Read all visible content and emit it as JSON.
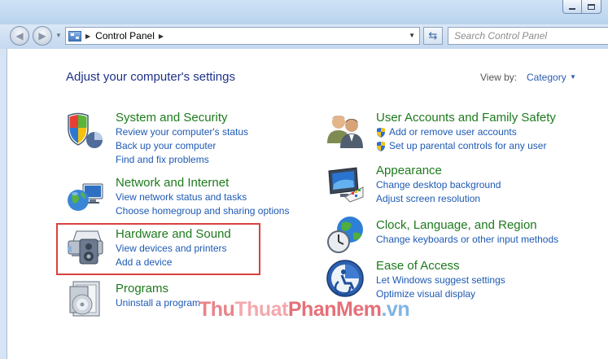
{
  "window": {
    "address": {
      "crumb": "Control Panel"
    },
    "search": {
      "placeholder": "Search Control Panel"
    }
  },
  "header": {
    "title": "Adjust your computer's settings",
    "view_by_label": "View by:",
    "view_by_value": "Category"
  },
  "categories": {
    "system": {
      "title": "System and Security",
      "icon": "shield-icon",
      "links": [
        "Review your computer's status",
        "Back up your computer",
        "Find and fix problems"
      ]
    },
    "network": {
      "title": "Network and Internet",
      "icon": "globe-network-icon",
      "links": [
        "View network status and tasks",
        "Choose homegroup and sharing options"
      ]
    },
    "hardware": {
      "title": "Hardware and Sound",
      "icon": "printer-speaker-icon",
      "links": [
        "View devices and printers",
        "Add a device"
      ]
    },
    "programs": {
      "title": "Programs",
      "icon": "programs-disc-icon",
      "links": [
        "Uninstall a program"
      ]
    },
    "users": {
      "title": "User Accounts and Family Safety",
      "icon": "users-icon",
      "links": [
        "Add or remove user accounts",
        "Set up parental controls for any user"
      ]
    },
    "appearance": {
      "title": "Appearance",
      "icon": "monitor-palette-icon",
      "links": [
        "Change desktop background",
        "Adjust screen resolution"
      ]
    },
    "clock": {
      "title": "Clock, Language, and Region",
      "icon": "clock-globe-icon",
      "links": [
        "Change keyboards or other input methods"
      ]
    },
    "ease": {
      "title": "Ease of Access",
      "icon": "accessibility-icon",
      "links": [
        "Let Windows suggest settings",
        "Optimize visual display"
      ]
    }
  },
  "watermark": {
    "part1": "Thu",
    "part2": "Thuat",
    "part3": "PhanMem",
    "part4": ".vn"
  },
  "colors": {
    "title_green": "#1d7a1d",
    "link_blue": "#1e5ab4",
    "highlight": "#d9413f"
  }
}
